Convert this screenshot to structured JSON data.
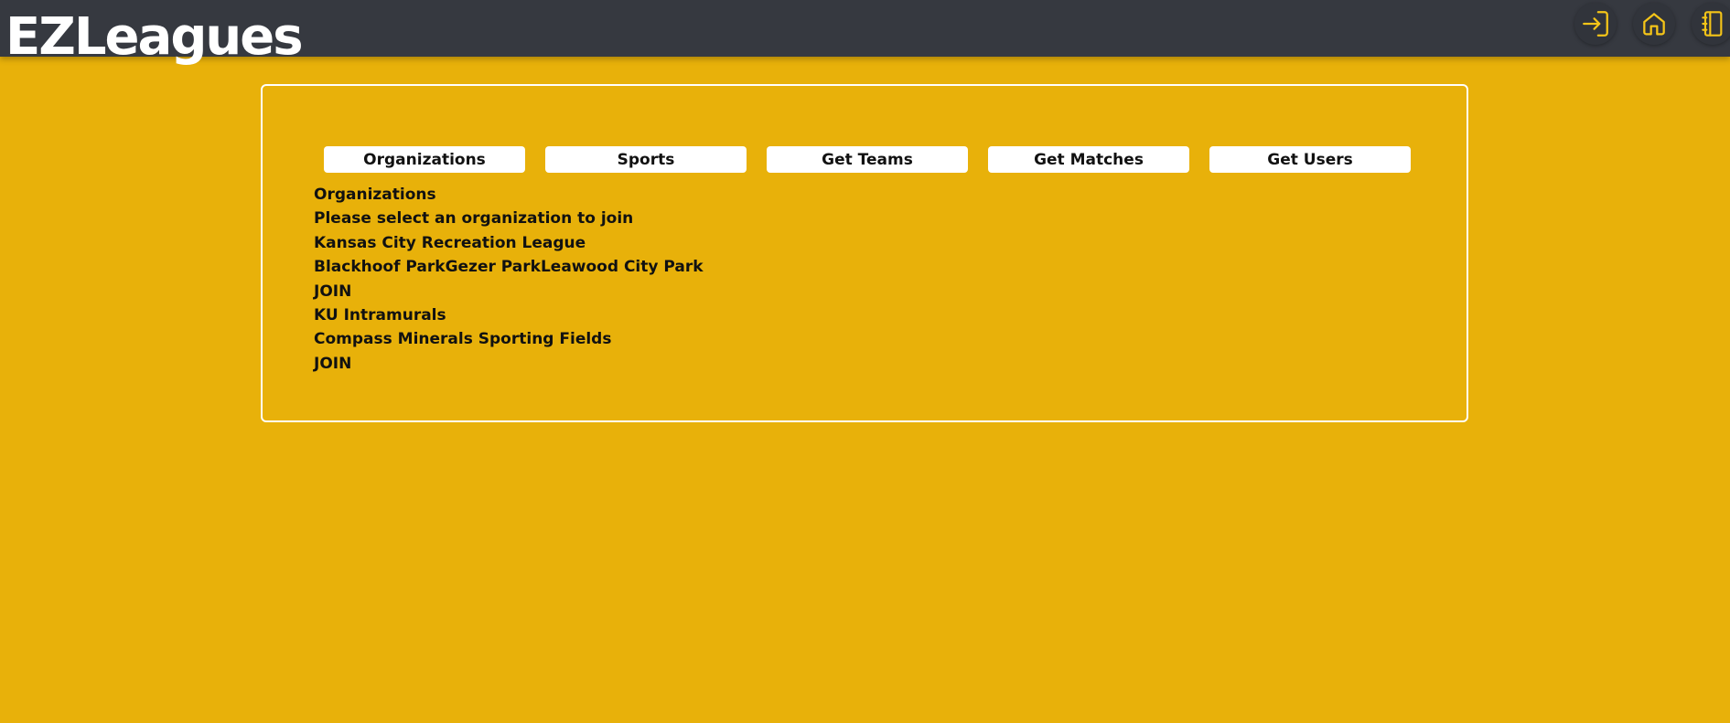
{
  "header": {
    "logo_text": "EZLeagues",
    "nav_icons": [
      "login-icon",
      "home-icon",
      "notebook-icon"
    ]
  },
  "colors": {
    "background": "#e8b10a",
    "header_bg": "#363940",
    "icon_color": "#f5c518",
    "panel_border": "#ffffff"
  },
  "tabs": [
    {
      "label": "Organizations"
    },
    {
      "label": "Sports"
    },
    {
      "label": "Get Teams"
    },
    {
      "label": "Get Matches"
    },
    {
      "label": "Get Users"
    }
  ],
  "content": {
    "heading": "Organizations",
    "instruction": "Please select an organization to join",
    "organizations": [
      {
        "name": "Kansas City Recreation League",
        "locations": "Blackhoof ParkGezer ParkLeawood City Park",
        "join_label": "JOIN"
      },
      {
        "name": "KU Intramurals",
        "locations": "Compass Minerals Sporting Fields",
        "join_label": "JOIN"
      }
    ]
  }
}
